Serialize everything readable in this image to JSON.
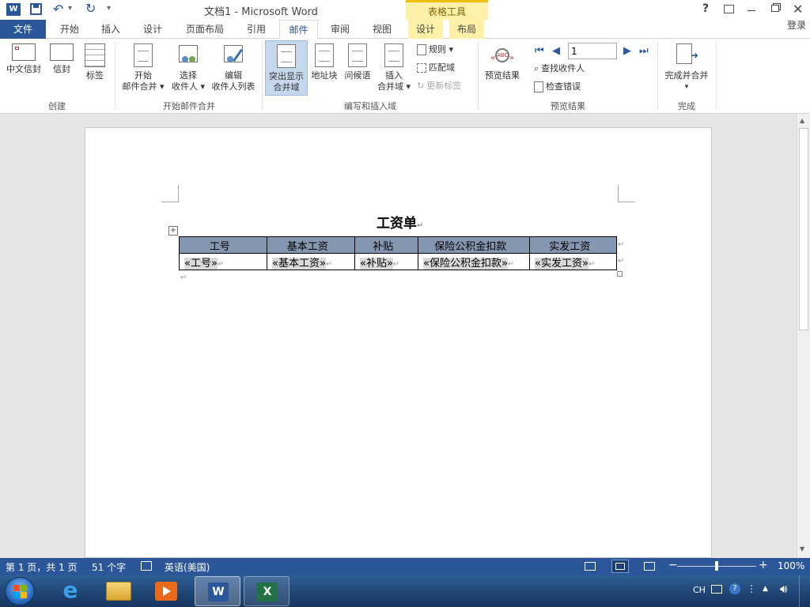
{
  "titlebar": {
    "title": "文档1 - Microsoft Word",
    "contextual_group": "表格工具",
    "help": "?",
    "undo_arrow": "▾",
    "customize": "▾"
  },
  "tabs": {
    "file": "文件",
    "items": [
      "开始",
      "插入",
      "设计",
      "页面布局",
      "引用",
      "邮件",
      "审阅",
      "视图"
    ],
    "contextual": [
      "设计",
      "布局"
    ],
    "login": "登录"
  },
  "ribbon": {
    "create": {
      "label": "创建",
      "chinese_envelope": "中文信封",
      "envelope": "信封",
      "labels": "标签"
    },
    "start": {
      "label": "开始邮件合并",
      "start_merge_1": "开始",
      "start_merge_2": "邮件合并",
      "select_1": "选择",
      "select_2": "收件人",
      "edit_1": "编辑",
      "edit_2": "收件人列表"
    },
    "write": {
      "label": "编写和插入域",
      "highlight_1": "突出显示",
      "highlight_2": "合并域",
      "address": "地址块",
      "greeting": "问候语",
      "insert_1": "插入",
      "insert_2": "合并域",
      "rules": "规则",
      "match": "匹配域",
      "update": "更新标签"
    },
    "preview": {
      "label": "预览结果",
      "preview_results": "预览结果",
      "record": "1",
      "find": "查找收件人",
      "check": "检查错误"
    },
    "finish": {
      "label": "完成",
      "finish_merge": "完成并合并"
    }
  },
  "document": {
    "title": "工资单",
    "headers": [
      "工号",
      "基本工资",
      "补贴",
      "保险公积金扣款",
      "实发工资"
    ],
    "fields": [
      "«工号»",
      "«基本工资»",
      "«补贴»",
      "«保险公积金扣款»",
      "«实发工资»"
    ],
    "para_mark": "↵"
  },
  "status": {
    "page": "第 1 页，共 1 页",
    "words": "51 个字",
    "language": "英语(美国)",
    "zoom": "100%",
    "zoom_percent": 100
  },
  "taskbar": {
    "lang": "CH"
  },
  "colors": {
    "accent": "#2b579a",
    "table_header": "#8496b0",
    "field_shade": "#d9d9d9",
    "contextual": "#fff2a8"
  }
}
